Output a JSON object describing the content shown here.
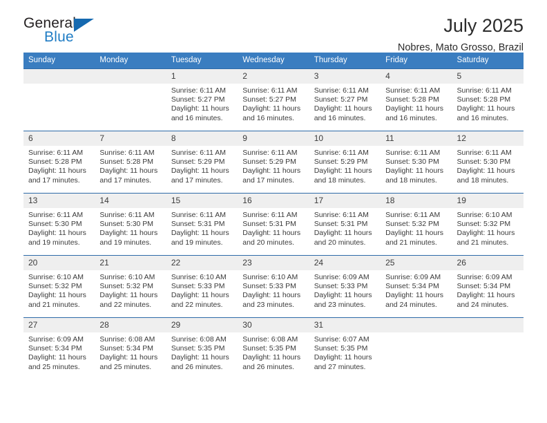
{
  "brand": {
    "name_top": "General",
    "name_bottom": "Blue",
    "triangle_color": "#1569b0",
    "blue_color": "#1f7cc4"
  },
  "header": {
    "title": "July 2025",
    "location": "Nobres, Mato Grosso, Brazil"
  },
  "theme": {
    "header_row_bg": "#3a7dc0",
    "row_divider": "#2d6aa8",
    "daynum_bg": "#efefef",
    "text": "#3a3a3a"
  },
  "weekdays": [
    "Sunday",
    "Monday",
    "Tuesday",
    "Wednesday",
    "Thursday",
    "Friday",
    "Saturday"
  ],
  "labels": {
    "sunrise_prefix": "Sunrise:",
    "sunset_prefix": "Sunset:",
    "daylight_prefix": "Daylight:"
  },
  "weeks": [
    [
      {
        "day": "",
        "blank": true
      },
      {
        "day": "",
        "blank": true
      },
      {
        "day": "1",
        "sunrise": "Sunrise: 6:11 AM",
        "sunset": "Sunset: 5:27 PM",
        "daylight": "Daylight: 11 hours and 16 minutes."
      },
      {
        "day": "2",
        "sunrise": "Sunrise: 6:11 AM",
        "sunset": "Sunset: 5:27 PM",
        "daylight": "Daylight: 11 hours and 16 minutes."
      },
      {
        "day": "3",
        "sunrise": "Sunrise: 6:11 AM",
        "sunset": "Sunset: 5:27 PM",
        "daylight": "Daylight: 11 hours and 16 minutes."
      },
      {
        "day": "4",
        "sunrise": "Sunrise: 6:11 AM",
        "sunset": "Sunset: 5:28 PM",
        "daylight": "Daylight: 11 hours and 16 minutes."
      },
      {
        "day": "5",
        "sunrise": "Sunrise: 6:11 AM",
        "sunset": "Sunset: 5:28 PM",
        "daylight": "Daylight: 11 hours and 16 minutes."
      }
    ],
    [
      {
        "day": "6",
        "sunrise": "Sunrise: 6:11 AM",
        "sunset": "Sunset: 5:28 PM",
        "daylight": "Daylight: 11 hours and 17 minutes."
      },
      {
        "day": "7",
        "sunrise": "Sunrise: 6:11 AM",
        "sunset": "Sunset: 5:28 PM",
        "daylight": "Daylight: 11 hours and 17 minutes."
      },
      {
        "day": "8",
        "sunrise": "Sunrise: 6:11 AM",
        "sunset": "Sunset: 5:29 PM",
        "daylight": "Daylight: 11 hours and 17 minutes."
      },
      {
        "day": "9",
        "sunrise": "Sunrise: 6:11 AM",
        "sunset": "Sunset: 5:29 PM",
        "daylight": "Daylight: 11 hours and 17 minutes."
      },
      {
        "day": "10",
        "sunrise": "Sunrise: 6:11 AM",
        "sunset": "Sunset: 5:29 PM",
        "daylight": "Daylight: 11 hours and 18 minutes."
      },
      {
        "day": "11",
        "sunrise": "Sunrise: 6:11 AM",
        "sunset": "Sunset: 5:30 PM",
        "daylight": "Daylight: 11 hours and 18 minutes."
      },
      {
        "day": "12",
        "sunrise": "Sunrise: 6:11 AM",
        "sunset": "Sunset: 5:30 PM",
        "daylight": "Daylight: 11 hours and 18 minutes."
      }
    ],
    [
      {
        "day": "13",
        "sunrise": "Sunrise: 6:11 AM",
        "sunset": "Sunset: 5:30 PM",
        "daylight": "Daylight: 11 hours and 19 minutes."
      },
      {
        "day": "14",
        "sunrise": "Sunrise: 6:11 AM",
        "sunset": "Sunset: 5:30 PM",
        "daylight": "Daylight: 11 hours and 19 minutes."
      },
      {
        "day": "15",
        "sunrise": "Sunrise: 6:11 AM",
        "sunset": "Sunset: 5:31 PM",
        "daylight": "Daylight: 11 hours and 19 minutes."
      },
      {
        "day": "16",
        "sunrise": "Sunrise: 6:11 AM",
        "sunset": "Sunset: 5:31 PM",
        "daylight": "Daylight: 11 hours and 20 minutes."
      },
      {
        "day": "17",
        "sunrise": "Sunrise: 6:11 AM",
        "sunset": "Sunset: 5:31 PM",
        "daylight": "Daylight: 11 hours and 20 minutes."
      },
      {
        "day": "18",
        "sunrise": "Sunrise: 6:11 AM",
        "sunset": "Sunset: 5:32 PM",
        "daylight": "Daylight: 11 hours and 21 minutes."
      },
      {
        "day": "19",
        "sunrise": "Sunrise: 6:10 AM",
        "sunset": "Sunset: 5:32 PM",
        "daylight": "Daylight: 11 hours and 21 minutes."
      }
    ],
    [
      {
        "day": "20",
        "sunrise": "Sunrise: 6:10 AM",
        "sunset": "Sunset: 5:32 PM",
        "daylight": "Daylight: 11 hours and 21 minutes."
      },
      {
        "day": "21",
        "sunrise": "Sunrise: 6:10 AM",
        "sunset": "Sunset: 5:32 PM",
        "daylight": "Daylight: 11 hours and 22 minutes."
      },
      {
        "day": "22",
        "sunrise": "Sunrise: 6:10 AM",
        "sunset": "Sunset: 5:33 PM",
        "daylight": "Daylight: 11 hours and 22 minutes."
      },
      {
        "day": "23",
        "sunrise": "Sunrise: 6:10 AM",
        "sunset": "Sunset: 5:33 PM",
        "daylight": "Daylight: 11 hours and 23 minutes."
      },
      {
        "day": "24",
        "sunrise": "Sunrise: 6:09 AM",
        "sunset": "Sunset: 5:33 PM",
        "daylight": "Daylight: 11 hours and 23 minutes."
      },
      {
        "day": "25",
        "sunrise": "Sunrise: 6:09 AM",
        "sunset": "Sunset: 5:34 PM",
        "daylight": "Daylight: 11 hours and 24 minutes."
      },
      {
        "day": "26",
        "sunrise": "Sunrise: 6:09 AM",
        "sunset": "Sunset: 5:34 PM",
        "daylight": "Daylight: 11 hours and 24 minutes."
      }
    ],
    [
      {
        "day": "27",
        "sunrise": "Sunrise: 6:09 AM",
        "sunset": "Sunset: 5:34 PM",
        "daylight": "Daylight: 11 hours and 25 minutes."
      },
      {
        "day": "28",
        "sunrise": "Sunrise: 6:08 AM",
        "sunset": "Sunset: 5:34 PM",
        "daylight": "Daylight: 11 hours and 25 minutes."
      },
      {
        "day": "29",
        "sunrise": "Sunrise: 6:08 AM",
        "sunset": "Sunset: 5:35 PM",
        "daylight": "Daylight: 11 hours and 26 minutes."
      },
      {
        "day": "30",
        "sunrise": "Sunrise: 6:08 AM",
        "sunset": "Sunset: 5:35 PM",
        "daylight": "Daylight: 11 hours and 26 minutes."
      },
      {
        "day": "31",
        "sunrise": "Sunrise: 6:07 AM",
        "sunset": "Sunset: 5:35 PM",
        "daylight": "Daylight: 11 hours and 27 minutes."
      },
      {
        "day": "",
        "blank": true
      },
      {
        "day": "",
        "blank": true
      }
    ]
  ]
}
